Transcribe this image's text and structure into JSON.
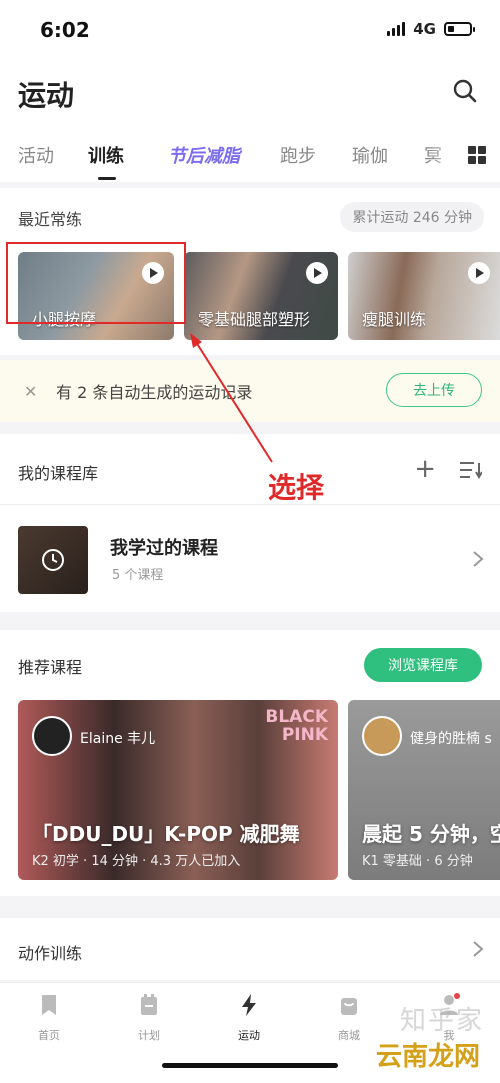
{
  "status_bar": {
    "time": "6:02",
    "network": "4G"
  },
  "header": {
    "title": "运动"
  },
  "tabs": [
    {
      "label": "活动"
    },
    {
      "label": "训练"
    },
    {
      "label": "节后减脂"
    },
    {
      "label": "跑步"
    },
    {
      "label": "瑜伽"
    },
    {
      "label": "冥"
    }
  ],
  "recent": {
    "title": "最近常练",
    "total": "累计运动 246 分钟",
    "cards": [
      {
        "label": "小腿按摩"
      },
      {
        "label": "零基础腿部塑形"
      },
      {
        "label": "瘦腿训练"
      }
    ]
  },
  "notice": {
    "text": "有 2 条自动生成的运动记录",
    "button": "去上传"
  },
  "annotation": {
    "text": "选择",
    "color": "#e02a2a"
  },
  "library": {
    "title": "我的课程库",
    "item_title": "我学过的课程",
    "item_sub": "5 个课程"
  },
  "recommend": {
    "title": "推荐课程",
    "button": "浏览课程库",
    "cards": [
      {
        "coach": "Elaine 丰儿",
        "logo_line1": "BLACK",
        "logo_line2": "PINK",
        "title": "「DDU_DU」K-POP 减肥舞",
        "meta": "K2 初学 · 14 分钟 · 4.3 万人已加入"
      },
      {
        "coach": "健身的胜楠 s",
        "title": "晨起 5 分钟，空",
        "meta": "K1 零基础 · 6 分钟"
      }
    ]
  },
  "action": {
    "title": "动作训练"
  },
  "bottom_nav": [
    {
      "label": "首页",
      "icon": "bookmark-icon"
    },
    {
      "label": "计划",
      "icon": "calendar-icon"
    },
    {
      "label": "运动",
      "icon": "lightning-icon"
    },
    {
      "label": "商城",
      "icon": "shopping-bag-icon"
    },
    {
      "label": "我",
      "icon": "person-icon"
    }
  ],
  "watermark": {
    "line1": "知乎家",
    "line2": "云南龙网"
  },
  "colors": {
    "accent_green": "#2fbf7f",
    "promo_purple": "#7b6cf0",
    "annotation_red": "#e02a2a"
  }
}
